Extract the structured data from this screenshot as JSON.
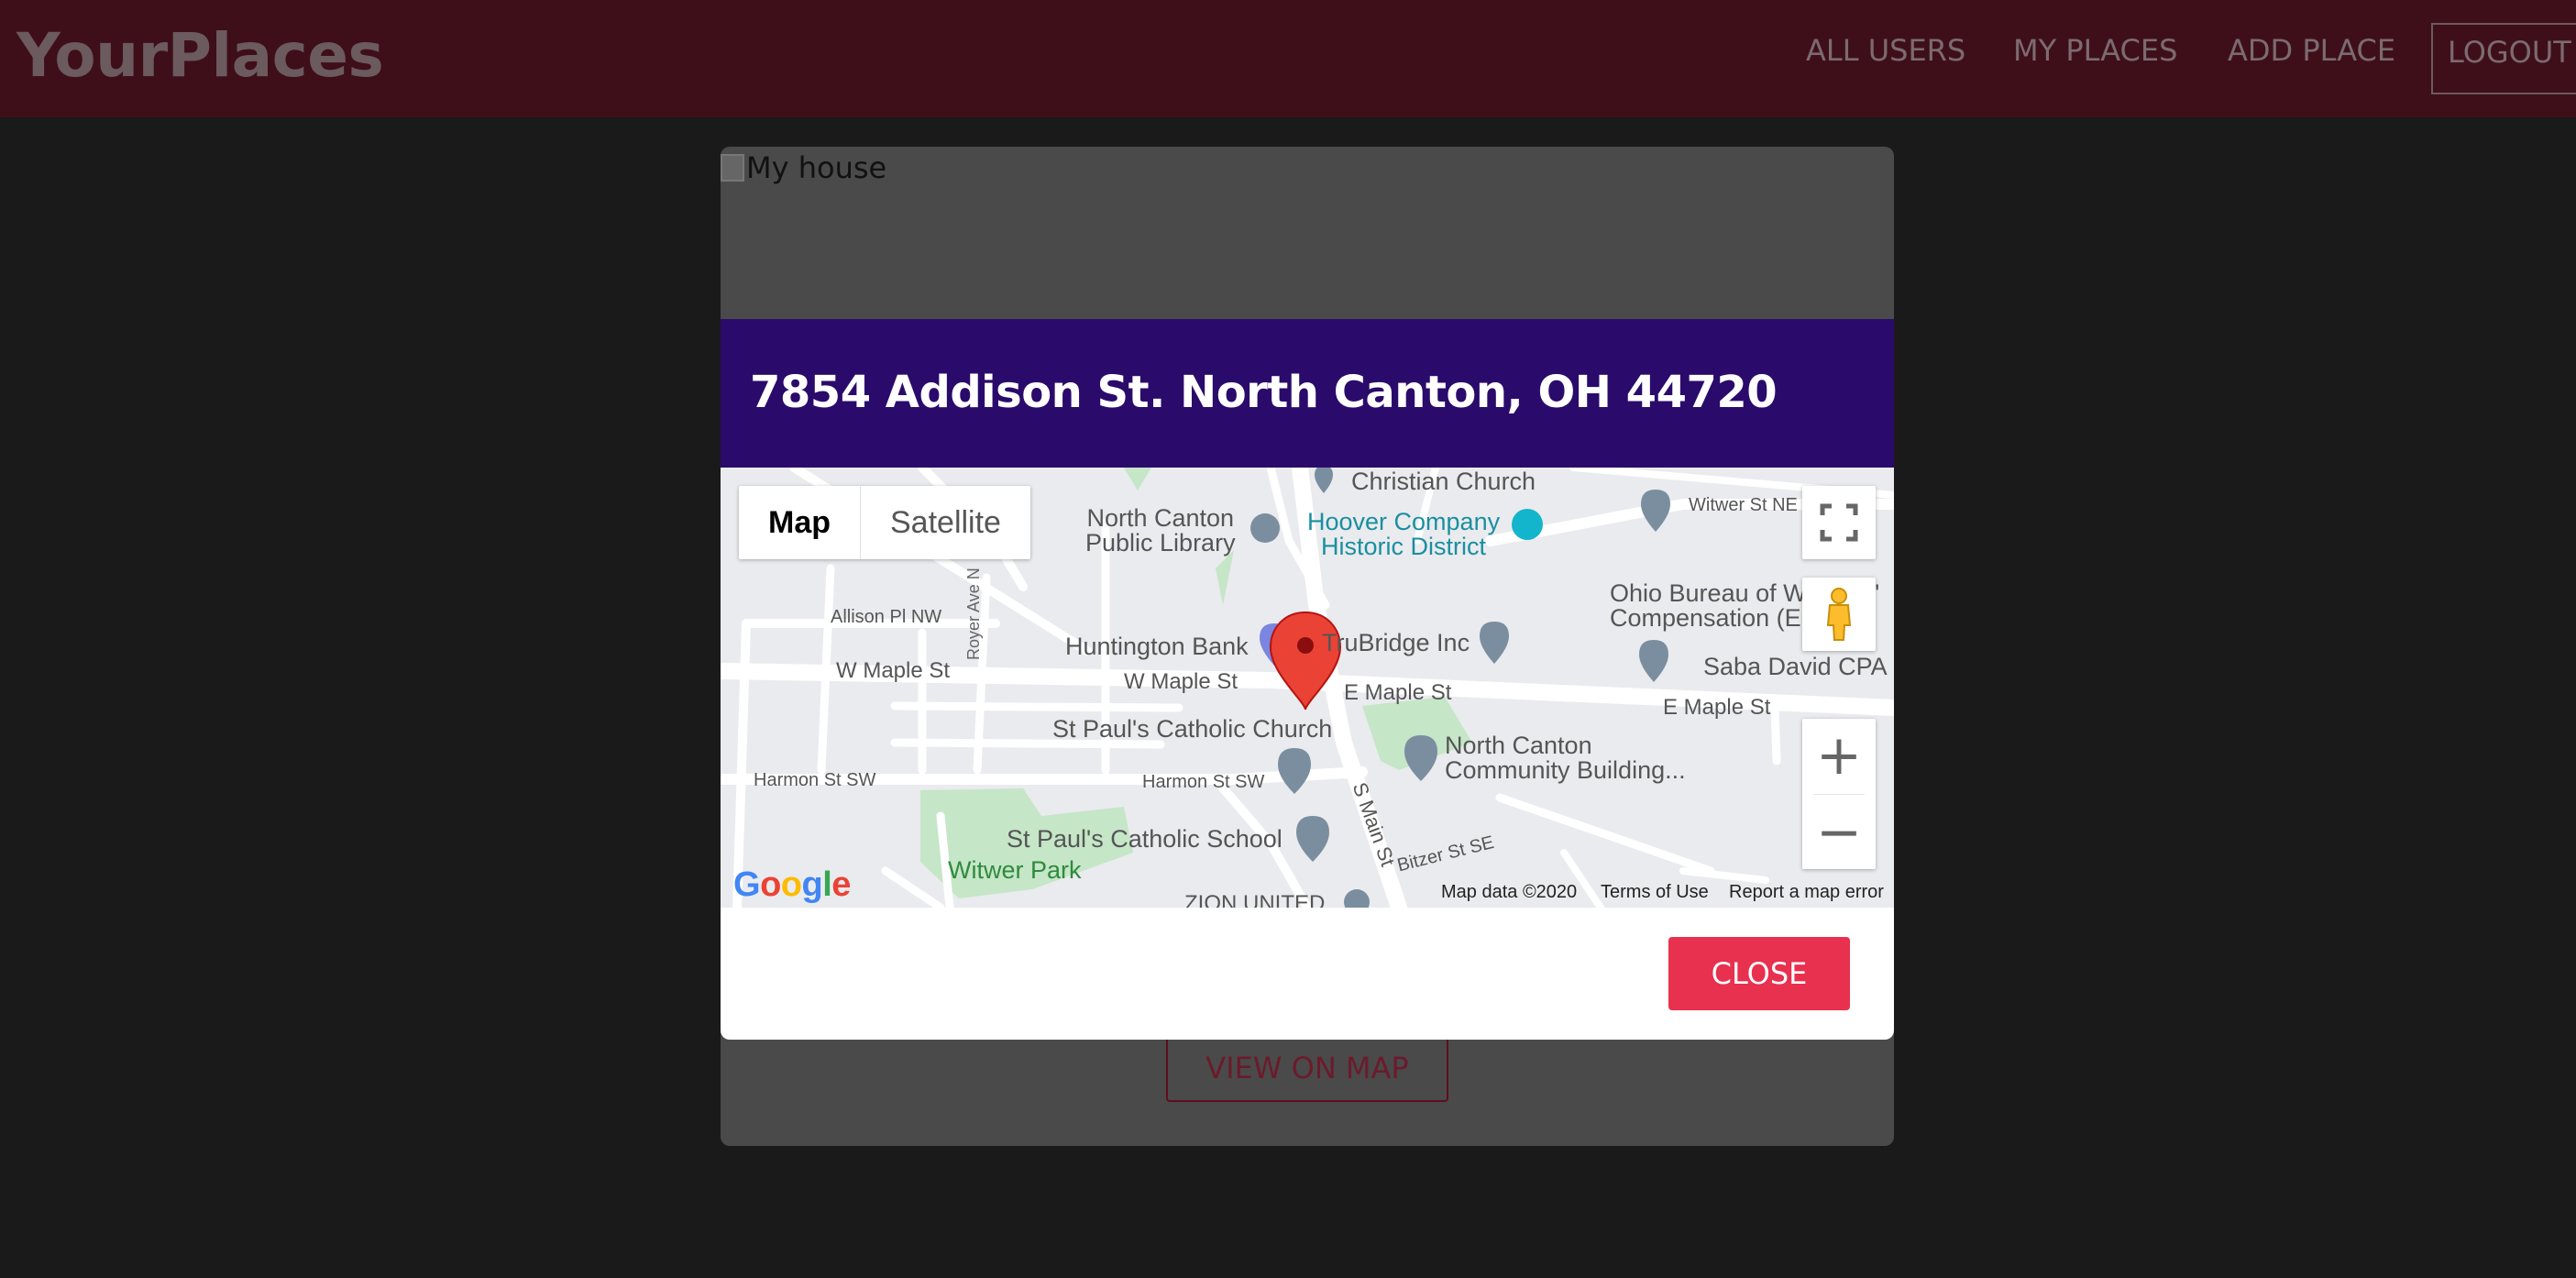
{
  "app": {
    "brand": "YourPlaces"
  },
  "nav": {
    "all_users": "ALL USERS",
    "my_places": "MY PLACES",
    "add_place": "ADD PLACE",
    "logout": "LOGOUT"
  },
  "place": {
    "image_alt": "My house",
    "view_on_map_label": "VIEW ON MAP"
  },
  "modal": {
    "title": "7854 Addison St. North Canton, OH 44720",
    "close_label": "CLOSE"
  },
  "map": {
    "type_map": "Map",
    "type_satellite": "Satellite",
    "zoom_in": "+",
    "zoom_out": "−",
    "google": "Google",
    "footer_data": "Map data ©2020",
    "footer_terms": "Terms of Use",
    "footer_report": "Report a map error",
    "labels": {
      "christian_church": "Christian Church",
      "witwer_st_ne": "Witwer St NE",
      "nc_public_library_1": "North Canton",
      "nc_public_library_2": "Public Library",
      "hoover_1": "Hoover Company",
      "hoover_2": "Historic District",
      "ohio_bureau_1": "Ohio Bureau of Workers'",
      "ohio_bureau_2": "Compensation (E",
      "royer_ave": "Royer Ave N",
      "allison_pl": "Allison Pl NW",
      "huntington": "Huntington Bank",
      "trubridge": "TruBridge Inc",
      "saba": "Saba David CPA",
      "w_maple_1": "W Maple St",
      "w_maple_2": "W Maple St",
      "e_maple_1": "E Maple St",
      "e_maple_2": "E Maple St",
      "st_pauls_church": "St Paul's Catholic Church",
      "nc_community_1": "North Canton",
      "nc_community_2": "Community Building...",
      "harmon_1": "Harmon St SW",
      "harmon_2": "Harmon St SW",
      "s_main": "S Main St",
      "st_pauls_school": "St Paul's Catholic School",
      "witwer_park": "Witwer Park",
      "bitzer": "Bitzer St SE",
      "zion": "ZION UNITED"
    }
  },
  "colors": {
    "header_bg": "#3f0f19",
    "modal_header_bg": "#2a0b6b",
    "close_button": "#e8304f",
    "marker": "#ea4335"
  }
}
